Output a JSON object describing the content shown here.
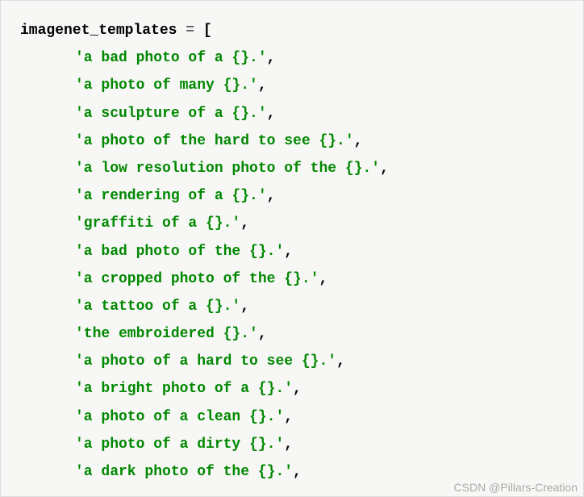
{
  "code": {
    "var_name": "imagenet_templates",
    "assign": " = ",
    "open_bracket": "[",
    "close_bracket": "]",
    "comma": ",",
    "strings": [
      "'a bad photo of a {}.'",
      "'a photo of many {}.'",
      "'a sculpture of a {}.'",
      "'a photo of the hard to see {}.'",
      "'a low resolution photo of the {}.'",
      "'a rendering of a {}.'",
      "'graffiti of a {}.'",
      "'a bad photo of the {}.'",
      "'a cropped photo of the {}.'",
      "'a tattoo of a {}.'",
      "'the embroidered {}.'",
      "'a photo of a hard to see {}.'",
      "'a bright photo of a {}.'",
      "'a photo of a clean {}.'",
      "'a photo of a dirty {}.'",
      "'a dark photo of the {}.'"
    ]
  },
  "watermark": "CSDN @Pillars-Creation"
}
